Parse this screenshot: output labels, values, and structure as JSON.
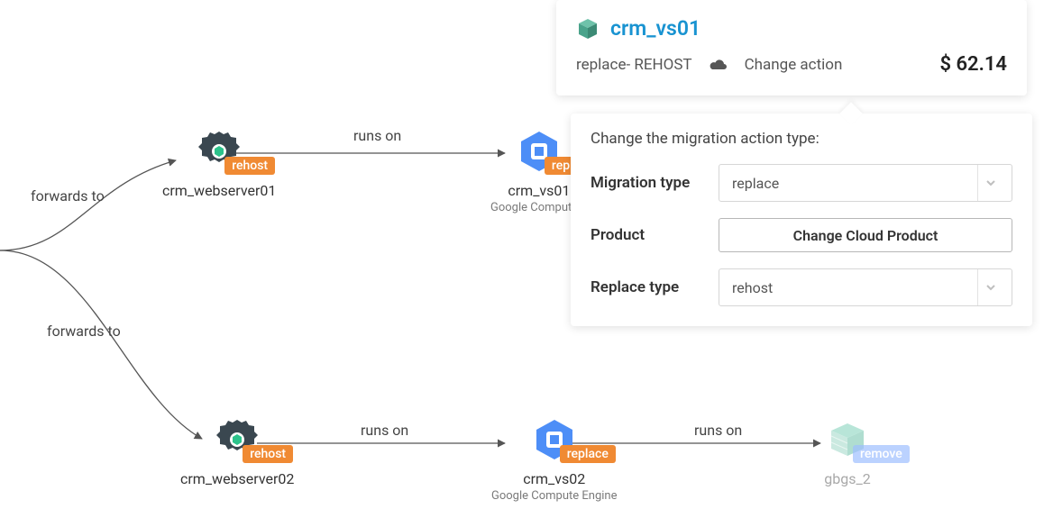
{
  "edges": {
    "forwards_to_1": "forwards to",
    "forwards_to_2": "forwards to",
    "runs_on_1": "runs on",
    "runs_on_2": "runs on",
    "runs_on_3": "runs on"
  },
  "nodes": {
    "ws1": {
      "label": "crm_webserver01",
      "tag": "rehost"
    },
    "ws2": {
      "label": "crm_webserver02",
      "tag": "rehost"
    },
    "vs1": {
      "label": "crm_vs01",
      "sublabel": "Google Compute E",
      "tag": "rep"
    },
    "vs2": {
      "label": "crm_vs02",
      "sublabel": "Google Compute Engine",
      "tag": "replace"
    },
    "gbgs2": {
      "label": "gbgs_2",
      "tag": "remove"
    }
  },
  "panel": {
    "title": "crm_vs01",
    "action_text": "replace- REHOST",
    "change_action_label": "Change action",
    "price": "$ 62.14"
  },
  "form": {
    "heading": "Change the migration action type:",
    "migration_type_label": "Migration type",
    "migration_type_value": "replace",
    "product_label": "Product",
    "product_button": "Change Cloud Product",
    "replace_type_label": "Replace type",
    "replace_type_value": "rehost"
  }
}
